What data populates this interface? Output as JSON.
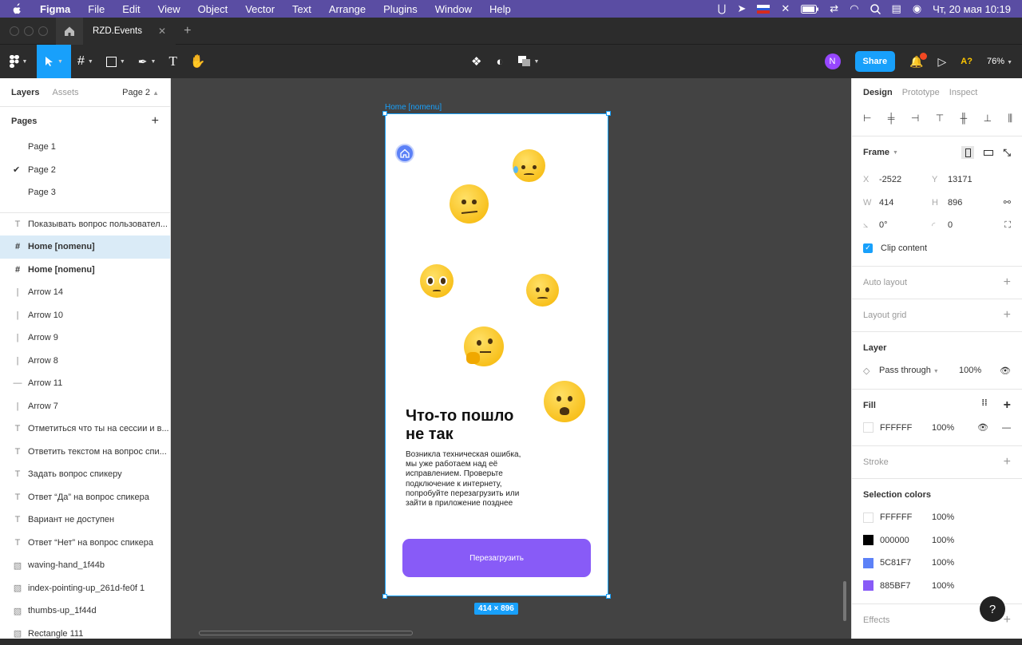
{
  "menubar": {
    "app": "Figma",
    "menus": [
      "File",
      "Edit",
      "View",
      "Object",
      "Vector",
      "Text",
      "Arrange",
      "Plugins",
      "Window",
      "Help"
    ],
    "clock": "Чт, 20 мая  10:19"
  },
  "tabs": {
    "file": "RZD.Events"
  },
  "toolbar": {
    "avatar_letter": "N",
    "share": "Share",
    "a_badge": "A?",
    "zoom": "76%"
  },
  "left_panel": {
    "tab_layers": "Layers",
    "tab_assets": "Assets",
    "page_selector": "Page 2",
    "pages_title": "Pages",
    "pages": [
      "Page 1",
      "Page 2",
      "Page 3"
    ],
    "layers": [
      {
        "icon": "T",
        "label": "Показывать вопрос пользовател..."
      },
      {
        "icon": "#",
        "label": "Home [nomenu]"
      },
      {
        "icon": "#",
        "label": "Home [nomenu]"
      },
      {
        "icon": "|",
        "label": "Arrow 14"
      },
      {
        "icon": "|",
        "label": "Arrow 10"
      },
      {
        "icon": "|",
        "label": "Arrow 9"
      },
      {
        "icon": "|",
        "label": "Arrow 8"
      },
      {
        "icon": "—",
        "label": "Arrow 11"
      },
      {
        "icon": "|",
        "label": "Arrow 7"
      },
      {
        "icon": "T",
        "label": "Отметиться что ты на сессии и в..."
      },
      {
        "icon": "T",
        "label": "Ответить текстом на вопрос спи..."
      },
      {
        "icon": "T",
        "label": "Задать вопрос спикеру"
      },
      {
        "icon": "T",
        "label": "Ответ “Да” на вопрос спикера"
      },
      {
        "icon": "T",
        "label": "Вариант не доступен"
      },
      {
        "icon": "T",
        "label": "Ответ “Нет” на вопрос спикера"
      },
      {
        "icon": "▧",
        "label": "waving-hand_1f44b"
      },
      {
        "icon": "▧",
        "label": "index-pointing-up_261d-fe0f 1"
      },
      {
        "icon": "▧",
        "label": "thumbs-up_1f44d"
      },
      {
        "icon": "▧",
        "label": "Rectangle 111"
      }
    ]
  },
  "canvas": {
    "frame_label": "Home [nomenu]",
    "error_title": "Что-то пошло не так",
    "error_text": "Возникла техническая ошибка, мы уже работаем над её исправлением. Проверьте подключение к интернету, попробуйте перезагрузить или зайти в приложение позднее",
    "reload_button": "Перезагрузить",
    "dimensions": "414 × 896"
  },
  "right_panel": {
    "tab_design": "Design",
    "tab_prototype": "Prototype",
    "tab_inspect": "Inspect",
    "frame_title": "Frame",
    "x_label": "X",
    "x": "-2522",
    "y_label": "Y",
    "y": "13171",
    "w_label": "W",
    "w": "414",
    "h_label": "H",
    "h": "896",
    "rotation": "0°",
    "radius": "0",
    "clip": "Clip content",
    "auto_layout": "Auto layout",
    "layout_grid": "Layout grid",
    "layer_title": "Layer",
    "blend": "Pass through",
    "layer_opacity": "100%",
    "fill_title": "Fill",
    "fill_hex": "FFFFFF",
    "fill_opacity": "100%",
    "stroke": "Stroke",
    "selection_colors_title": "Selection colors",
    "selection_colors": [
      {
        "hex": "FFFFFF",
        "opacity": "100%",
        "color": "#FFFFFF"
      },
      {
        "hex": "000000",
        "opacity": "100%",
        "color": "#000000"
      },
      {
        "hex": "5C81F7",
        "opacity": "100%",
        "color": "#5C81F7"
      },
      {
        "hex": "885BF7",
        "opacity": "100%",
        "color": "#885BF7"
      }
    ],
    "effects": "Effects"
  },
  "colors": {
    "accent": "#18a0fb",
    "purple": "#885bf7",
    "blue": "#5c81f7"
  }
}
